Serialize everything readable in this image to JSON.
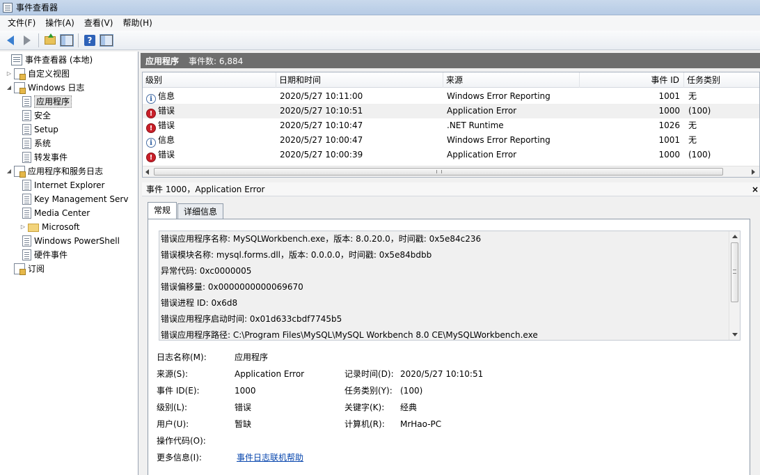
{
  "window": {
    "title": "事件查看器"
  },
  "menu": [
    "文件(F)",
    "操作(A)",
    "查看(V)",
    "帮助(H)"
  ],
  "toolbar": {
    "help_glyph": "?"
  },
  "tree": {
    "root": "事件查看器 (本地)",
    "custom_views": "自定义视图",
    "windows_logs": "Windows 日志",
    "windows_log_items": [
      "应用程序",
      "安全",
      "Setup",
      "系统",
      "转发事件"
    ],
    "app_service_logs": "应用程序和服务日志",
    "app_service_items": [
      "Internet Explorer",
      "Key Management Serv",
      "Media Center",
      "Microsoft",
      "Windows PowerShell",
      "硬件事件"
    ],
    "subscriptions": "订阅"
  },
  "header": {
    "title": "应用程序",
    "count": "事件数: 6,884"
  },
  "list": {
    "columns": [
      "级别",
      "日期和时间",
      "来源",
      "事件 ID",
      "任务类别"
    ],
    "rows": [
      {
        "level": "信息",
        "level_icon": "info-icon",
        "datetime": "2020/5/27 10:11:00",
        "source": "Windows Error Reporting",
        "id": "1001",
        "task": "无"
      },
      {
        "level": "错误",
        "level_icon": "error-icon",
        "datetime": "2020/5/27 10:10:51",
        "source": "Application Error",
        "id": "1000",
        "task": "(100)"
      },
      {
        "level": "错误",
        "level_icon": "error-icon",
        "datetime": "2020/5/27 10:10:47",
        "source": ".NET Runtime",
        "id": "1026",
        "task": "无"
      },
      {
        "level": "信息",
        "level_icon": "info-icon",
        "datetime": "2020/5/27 10:00:47",
        "source": "Windows Error Reporting",
        "id": "1001",
        "task": "无"
      },
      {
        "level": "错误",
        "level_icon": "error-icon",
        "datetime": "2020/5/27 10:00:39",
        "source": "Application Error",
        "id": "1000",
        "task": "(100)"
      }
    ]
  },
  "detail": {
    "title": "事件 1000，Application Error",
    "close": "×",
    "tabs": [
      "常规",
      "详细信息"
    ],
    "description": [
      "错误应用程序名称: MySQLWorkbench.exe，版本: 8.0.20.0，时间戳: 0x5e84c236",
      "错误模块名称: mysql.forms.dll，版本: 0.0.0.0，时间戳: 0x5e84bdbb",
      "异常代码: 0xc0000005",
      "错误偏移量: 0x0000000000069670",
      "错误进程 ID: 0x6d8",
      "错误应用程序启动时间: 0x01d633cbdf7745b5",
      "错误应用程序路径: C:\\Program Files\\MySQL\\MySQL Workbench 8.0 CE\\MySQLWorkbench.exe"
    ],
    "props": {
      "log_name_label": "日志名称(M):",
      "log_name": "应用程序",
      "source_label": "来源(S):",
      "source": "Application Error",
      "logged_label": "记录时间(D):",
      "logged": "2020/5/27 10:10:51",
      "event_id_label": "事件 ID(E):",
      "event_id": "1000",
      "task_label": "任务类别(Y):",
      "task": "(100)",
      "level_label": "级别(L):",
      "level": "错误",
      "keywords_label": "关键字(K):",
      "keywords": "经典",
      "user_label": "用户(U):",
      "user": "暂缺",
      "computer_label": "计算机(R):",
      "computer": "MrHao-PC",
      "opcode_label": "操作代码(O):",
      "more_info_label": "更多信息(I):",
      "more_info_link": "事件日志联机帮助"
    }
  }
}
